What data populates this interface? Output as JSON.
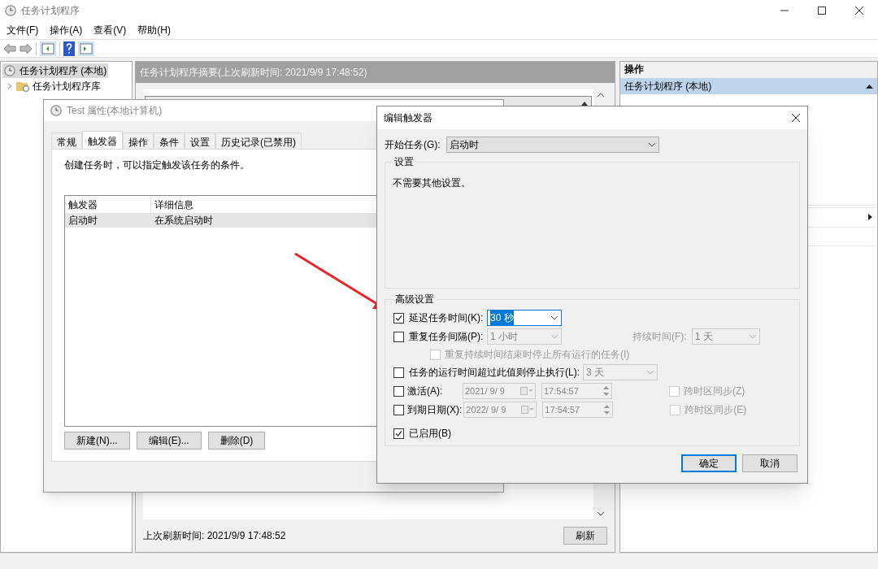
{
  "window": {
    "title": "任务计划程序"
  },
  "menu": [
    "文件(F)",
    "操作(A)",
    "查看(V)",
    "帮助(H)"
  ],
  "tree": [
    {
      "label": "任务计划程序 (本地)",
      "selected": true,
      "children": [
        {
          "label": "任务计划程序库",
          "expanded": false,
          "selected": false
        }
      ]
    }
  ],
  "summary": {
    "header": "任务计划程序摘要(上次刷新时间: 2021/9/9 17:48:52)",
    "footer": "上次刷新时间: 2021/9/9 17:48:52",
    "refresh_button": "刷新"
  },
  "actions": {
    "title": "操作",
    "group": "任务计划程序 (本地)",
    "expanded": true
  },
  "properties_dialog": {
    "title": "Test 属性(本地计算机)",
    "tabs": [
      {
        "label": "常规",
        "selected": false
      },
      {
        "label": "触发器",
        "selected": true
      },
      {
        "label": "操作",
        "selected": false
      },
      {
        "label": "条件",
        "selected": false
      },
      {
        "label": "设置",
        "selected": false
      },
      {
        "label": "历史记录(已禁用)",
        "selected": false
      }
    ],
    "description": "创建任务时，可以指定触发该任务的条件。",
    "columns": [
      "触发器",
      "详细信息"
    ],
    "rows": [
      {
        "cells": [
          "启动时",
          "在系统启动时"
        ],
        "selected": true
      }
    ],
    "buttons": [
      "新建(N)...",
      "编辑(E)...",
      "删除(D)"
    ]
  },
  "trigger_dialog": {
    "title": "编辑触发器",
    "start_label": "开始任务(G):",
    "start_value": "启动时",
    "settings_title": "设置",
    "settings_text": "不需要其他设置。",
    "advanced_title": "高级设置",
    "rows": [
      {
        "kind": "dropdown",
        "label": "延迟任务时间(K):",
        "checked": true,
        "value": "30 秒",
        "focused": true
      },
      {
        "kind": "dropdown",
        "label": "重复任务间隔(P):",
        "checked": false,
        "value": "1 小时",
        "focused": false,
        "extra_label": "持续时间(F):",
        "extra_value": "1 天"
      },
      {
        "kind": "sub_check",
        "label": "重复持续时间结束时停止所有运行的任务(I)",
        "checked": false,
        "disabled": true
      },
      {
        "kind": "dropdown",
        "label": "任务的运行时间超过此值则停止执行(L):",
        "checked": false,
        "value": "3 天",
        "focused": false
      },
      {
        "kind": "datetime",
        "label": "激活(A):",
        "checked": false,
        "date": "2021/ 9/ 9",
        "time": "17:54:57",
        "sync_label": "跨时区同步(Z)",
        "sync_checked": false
      },
      {
        "kind": "datetime",
        "label": "到期日期(X):",
        "checked": false,
        "date": "2022/ 9/ 9",
        "time": "17:54:57",
        "sync_label": "跨时区同步(E)",
        "sync_checked": false
      },
      {
        "kind": "check",
        "label": "已启用(B)",
        "checked": true
      }
    ],
    "buttons": [
      {
        "label": "确定",
        "default": true
      },
      {
        "label": "取消",
        "default": false
      }
    ]
  }
}
